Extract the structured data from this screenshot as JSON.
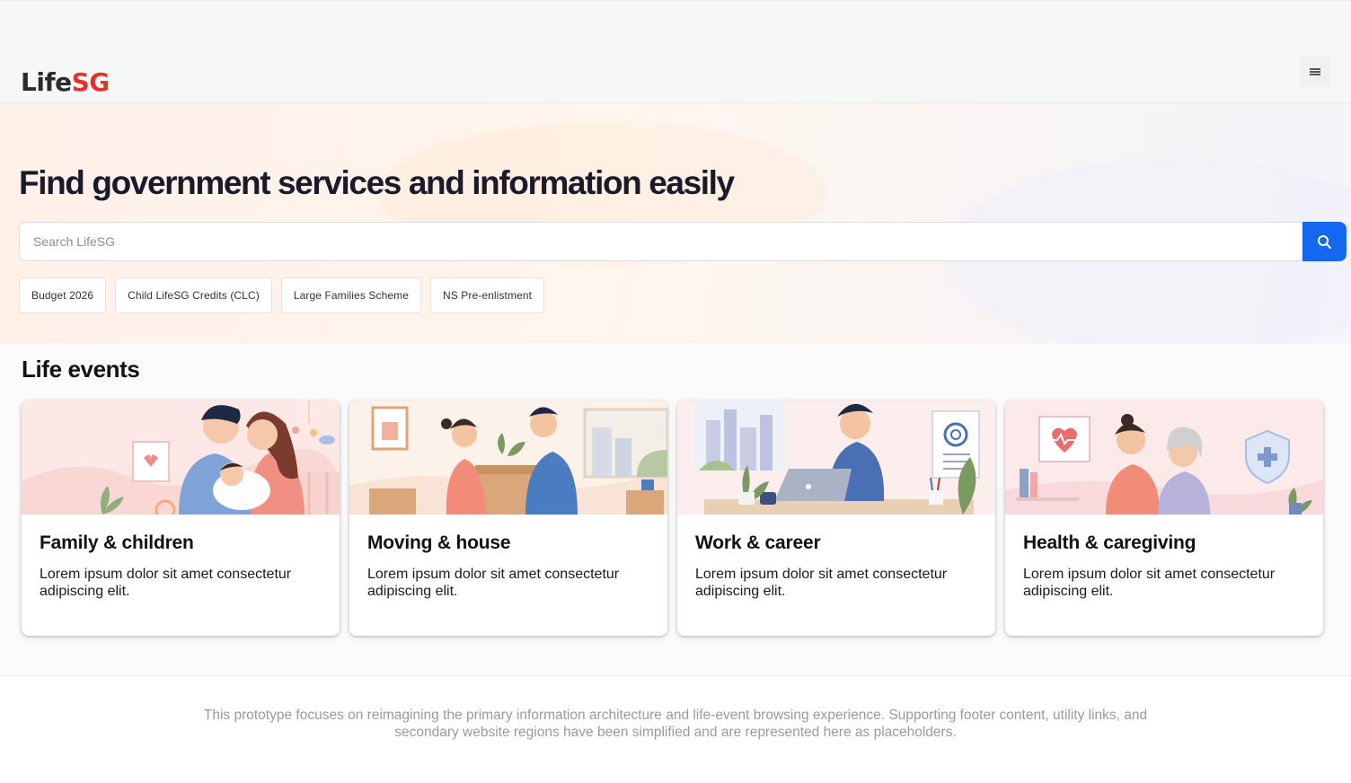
{
  "header": {
    "logo_life": "Life",
    "logo_sg": "SG",
    "menu_icon": "hamburger-menu-icon"
  },
  "hero": {
    "title": "Find government services and information easily",
    "search": {
      "placeholder": "Search LifeSG",
      "button_icon": "search-icon"
    },
    "quick_links": [
      "Budget 2026",
      "Child LifeSG Credits (CLC)",
      "Large Families Scheme",
      "NS Pre-enlistment"
    ]
  },
  "life_events": {
    "title": "Life events",
    "cards": [
      {
        "title": "Family & children",
        "description": "Lorem ipsum dolor sit amet consectetur adipiscing elit.",
        "illustration": "family-illustration"
      },
      {
        "title": "Moving & house",
        "description": "Lorem ipsum dolor sit amet consectetur adipiscing elit.",
        "illustration": "moving-illustration"
      },
      {
        "title": "Work & career",
        "description": "Lorem ipsum dolor sit amet consectetur adipiscing elit.",
        "illustration": "work-illustration"
      },
      {
        "title": "Health & caregiving",
        "description": "Lorem ipsum dolor sit amet consectetur adipiscing elit.",
        "illustration": "health-illustration"
      }
    ]
  },
  "footer": {
    "note": "This prototype focuses on reimagining the primary information architecture and life-event browsing experience. Supporting footer content, utility links, and secondary website regions have been simplified and are represented here as placeholders."
  },
  "colors": {
    "brand_red": "#e5322d",
    "primary_blue": "#1468f0",
    "hero_bg": "#fff2ea"
  }
}
